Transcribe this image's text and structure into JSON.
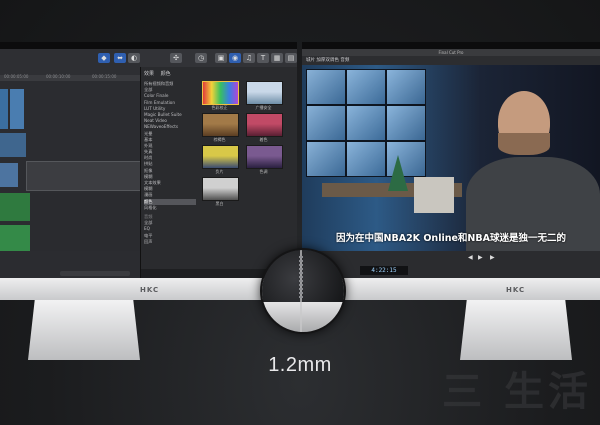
{
  "left_monitor": {
    "brand": "HKC",
    "ruler_times": [
      "00:00:05:00",
      "00:00:10:00",
      "00:00:15:00"
    ],
    "effects_panel": {
      "tabs": [
        "效果",
        "颜色"
      ],
      "heading": "所有视频和音频",
      "categories": [
        "全部",
        "Color Finale",
        "Film Emulation",
        "LUT Utility",
        "Magic Bullet Suite",
        "Neat Video",
        "NEWaveoEffects",
        "光晕",
        "基本",
        "外观",
        "失真",
        "时尚",
        "拼贴",
        "抠像",
        "模糊",
        "文本效果",
        "模糊",
        "漫画",
        "颜色",
        "风格化"
      ],
      "selected_category": "颜色",
      "audio_header": "音频",
      "audio_items": [
        "全部",
        "EQ",
        "电平",
        "回声"
      ],
      "thumbnails": [
        {
          "label": "色彩校正",
          "colors": [
            "#e23b3b",
            "#f2d23a",
            "#38c060",
            "#3a7ee2",
            "#b046d8"
          ],
          "selected": true
        },
        {
          "label": "广播安全",
          "colors": [
            "#c9d8e8",
            "#6f8fa8"
          ]
        },
        {
          "label": "棕褐色",
          "colors": [
            "#a27a48",
            "#5b3e22"
          ]
        },
        {
          "label": "着色",
          "colors": [
            "#c14a66",
            "#5a1f33"
          ]
        },
        {
          "label": "负片",
          "colors": [
            "#d8c848",
            "#3a4a70"
          ]
        },
        {
          "label": "色调",
          "colors": [
            "#7a5a90",
            "#2a2040"
          ]
        },
        {
          "label": "黑白",
          "colors": [
            "#d0d0d0",
            "#505050"
          ]
        }
      ]
    }
  },
  "right_monitor": {
    "brand": "HKC",
    "app_title": "Final Cut Pro",
    "viewer_bar": "城片 加厚双调色 音频",
    "subtitle": "因为在中国NBA2K Online和NBA球迷是独一无二的",
    "timecode": "4:22:15"
  },
  "caption": "1.2mm",
  "watermark": "三 生活"
}
